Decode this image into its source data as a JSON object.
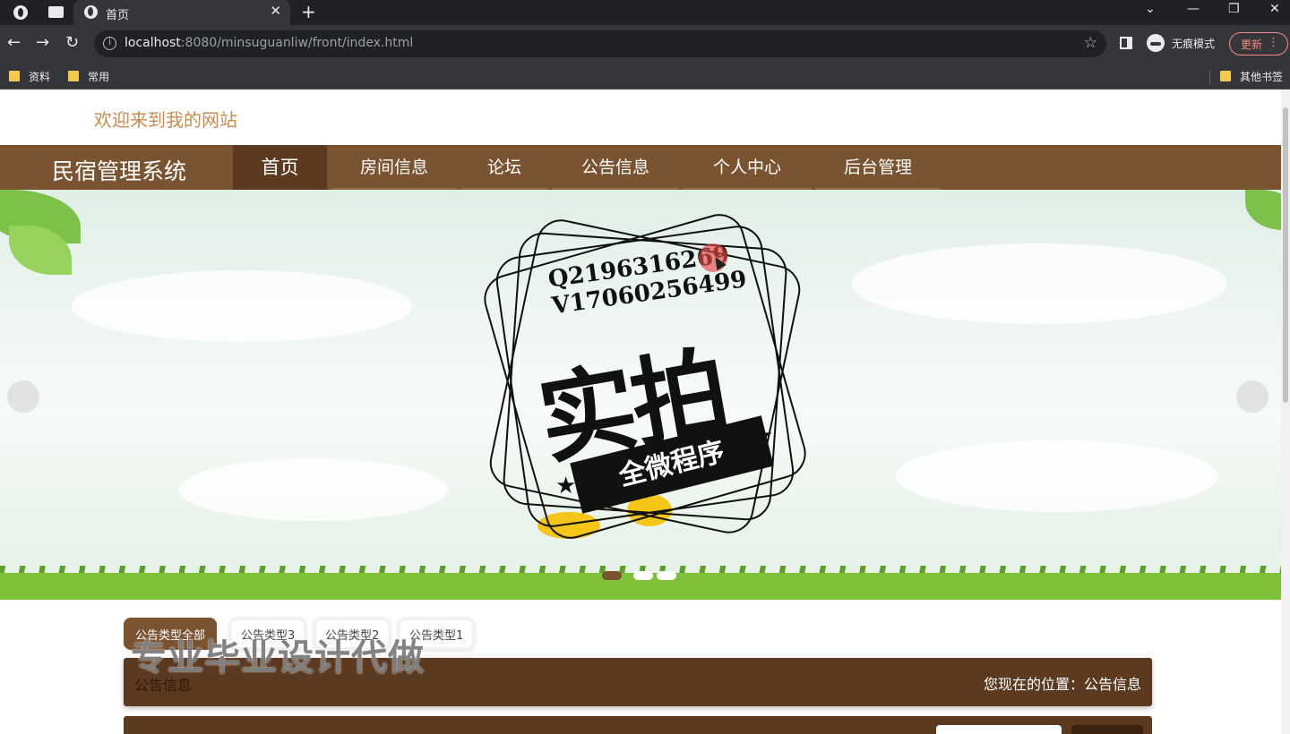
{
  "browser": {
    "tab_title": "首页",
    "tab_close": "✕",
    "new_tab": "+",
    "window_controls": {
      "minimize": "⌄",
      "restore": "—",
      "maximize": "❐",
      "close": "✕"
    },
    "nav": {
      "back": "←",
      "forward": "→",
      "reload": "↻"
    },
    "url_host": "localhost",
    "url_rest": ":8080/minsuguanliw/front/index.html",
    "info_icon": "i",
    "bookmark_star": "☆",
    "incognito_label": "无痕模式",
    "update_label": "更新",
    "update_menu": "⋮",
    "bookmarks": [
      "资料",
      "常用"
    ],
    "other_bookmarks": "其他书签"
  },
  "site": {
    "welcome": "欢迎来到我的网站",
    "brand": "民宿管理系统",
    "nav_items": [
      {
        "label": "首页",
        "active": true
      },
      {
        "label": "房间信息"
      },
      {
        "label": "论坛"
      },
      {
        "label": "公告信息"
      },
      {
        "label": "个人中心"
      },
      {
        "label": "后台管理"
      }
    ]
  },
  "banner": {
    "stamp_phone_q": "Q2196316269",
    "stamp_phone_v": "V17060256499",
    "stamp_big": "实拍",
    "stamp_ribbon": "全微程序",
    "slides_count": 3,
    "active_slide": 1
  },
  "filters": [
    "公告类型全部",
    "公告类型3",
    "公告类型2",
    "公告类型1"
  ],
  "section": {
    "title": "公告信息",
    "breadcrumb": "您现在的位置：公告信息"
  },
  "watermark": "专业毕业设计代做",
  "colors": {
    "nav_brown": "#7a5330",
    "dark_brown": "#5b3a1f",
    "welcome_orange": "#c98a4e"
  }
}
